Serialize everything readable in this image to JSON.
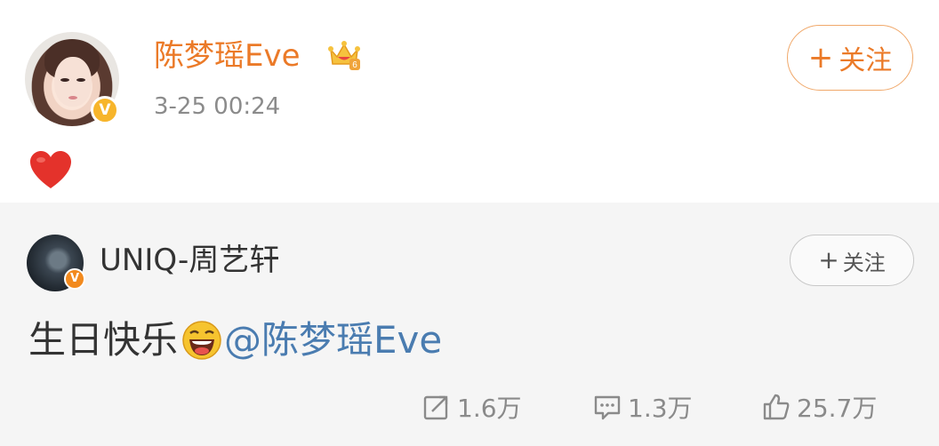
{
  "post": {
    "author": "陈梦瑶Eve",
    "timestamp": "3-25 00:24",
    "follow_label": "关注",
    "content_emoji": "red-heart",
    "verified_badge": "V",
    "crown_level": "6"
  },
  "repost": {
    "author": "UNIQ-周艺轩",
    "follow_label": "关注",
    "text": "生日快乐",
    "emoji": "laughing-face",
    "mention": "@陈梦瑶Eve",
    "verified_badge": "V"
  },
  "stats": {
    "reposts": "1.6万",
    "comments": "1.3万",
    "likes": "25.7万"
  },
  "colors": {
    "accent_orange": "#eb7a28",
    "mention_blue": "#4a7cb0",
    "badge_gold": "#f7b52b",
    "repost_bg": "#f5f5f5"
  }
}
